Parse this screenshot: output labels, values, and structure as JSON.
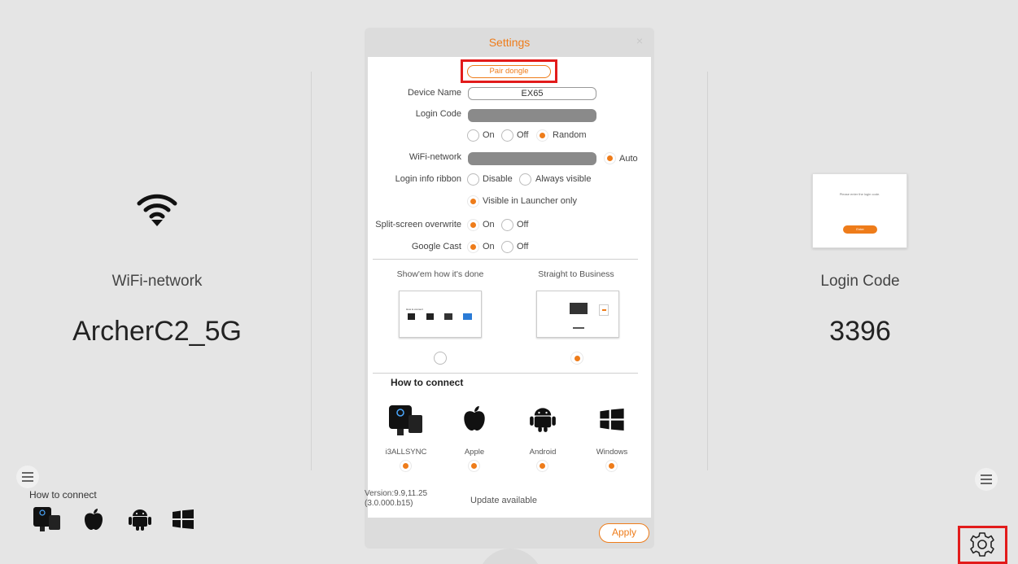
{
  "left_panel": {
    "wifi_label": "WiFi-network",
    "wifi_value": "ArcherC2_5G",
    "how_to_connect": "How to connect"
  },
  "right_panel": {
    "login_label": "Login Code",
    "login_value": "3396",
    "thumb_prompt": "Please enter the login code.",
    "thumb_button": "Enter"
  },
  "dialog": {
    "title": "Settings",
    "close": "×",
    "pair_dongle": "Pair dongle",
    "device_name_label": "Device Name",
    "device_name_value": "EX65",
    "login_code_label": "Login Code",
    "login_code_options": [
      "On",
      "Off",
      "Random"
    ],
    "wifi_label": "WiFi-network",
    "wifi_auto": "Auto",
    "ribbon_label": "Login info ribbon",
    "ribbon_options": [
      "Disable",
      "Always visible",
      "Visible in Launcher only"
    ],
    "split_label": "Split-screen overwrite",
    "split_options": [
      "On",
      "Off"
    ],
    "cast_label": "Google Cast",
    "cast_options": [
      "On",
      "Off"
    ],
    "preview_left": "Show'em how it's done",
    "preview_right": "Straight to Business",
    "how_to_connect": "How to connect",
    "os": [
      "i3ALLSYNC",
      "Apple",
      "Android",
      "Windows"
    ],
    "version_line1": "Version:9.9,11.25",
    "version_line2": "(3.0.000.b15)",
    "update": "Update available",
    "apply": "Apply"
  },
  "colors": {
    "accent": "#ee7c1a",
    "highlight": "#e21b1b",
    "background": "#e5e5e5"
  }
}
